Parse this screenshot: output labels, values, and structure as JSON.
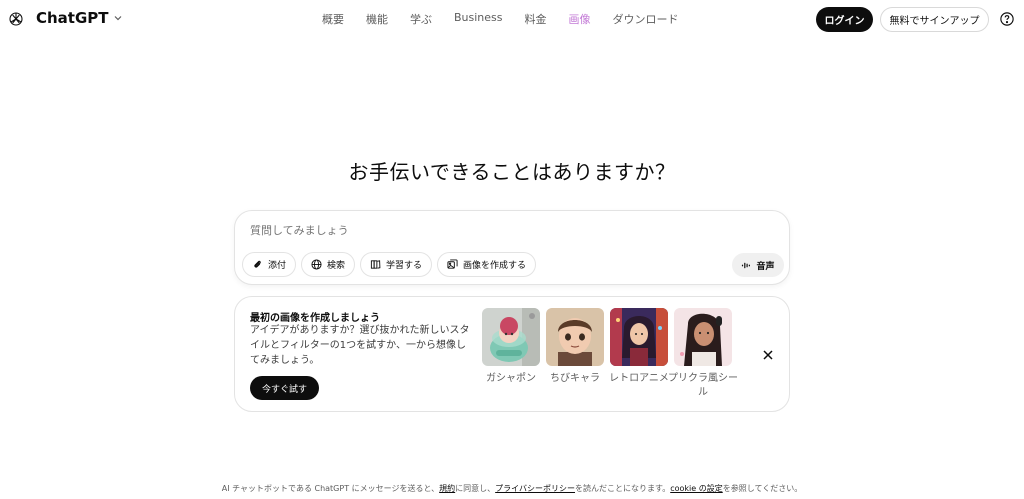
{
  "header": {
    "brand": "ChatGPT",
    "nav": [
      "概要",
      "機能",
      "学ぶ",
      "Business",
      "料金",
      "画像",
      "ダウンロード"
    ],
    "active_nav": "画像",
    "login_label": "ログイン",
    "signup_label": "無料でサインアップ",
    "accent_color": "#c37ad6"
  },
  "main": {
    "heading": "お手伝いできることはありますか？",
    "composer": {
      "placeholder": "質問してみましょう",
      "tools": [
        {
          "label": "添付",
          "icon": "paperclip-icon"
        },
        {
          "label": "検索",
          "icon": "globe-icon"
        },
        {
          "label": "学習する",
          "icon": "book-icon"
        },
        {
          "label": "画像を作成する",
          "icon": "image-icon"
        }
      ],
      "voice_label": "音声"
    },
    "promo": {
      "title": "最初の画像を作成しましょう",
      "desc": "アイデアがありますか？選び抜かれた新しいスタイルとフィルターの1つを試すか、一から想像してみましょう。",
      "try_label": "今すぐ試す",
      "styles": [
        {
          "label": "ガシャポン"
        },
        {
          "label": "ちびキャラ"
        },
        {
          "label": "レトロアニメ"
        },
        {
          "label": "プリクラ風シール"
        }
      ]
    }
  },
  "footer": {
    "text_a": "AI チャットボットである ChatGPT にメッセージを送ると、",
    "link_terms": "規約",
    "text_b": "に同意し、",
    "link_privacy": "プライバシーポリシー",
    "text_c": "を読んだことになります。",
    "link_cookie": "cookie の設定",
    "text_d": "を参照してください。"
  }
}
